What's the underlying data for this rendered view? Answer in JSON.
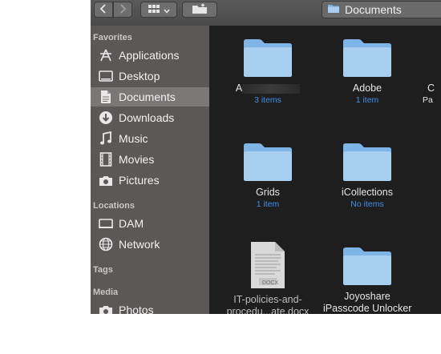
{
  "toolbar": {
    "back_icon": "chevron-left-icon",
    "forward_icon": "chevron-right-icon",
    "path_label": "Documents"
  },
  "sidebar": {
    "favorites_label": "Favorites",
    "favorites": [
      {
        "label": "Applications",
        "icon": "applications-icon"
      },
      {
        "label": "Desktop",
        "icon": "desktop-icon"
      },
      {
        "label": "Documents",
        "icon": "documents-icon",
        "selected": true
      },
      {
        "label": "Downloads",
        "icon": "downloads-icon"
      },
      {
        "label": "Music",
        "icon": "music-icon"
      },
      {
        "label": "Movies",
        "icon": "movies-icon"
      },
      {
        "label": "Pictures",
        "icon": "pictures-icon"
      }
    ],
    "locations_label": "Locations",
    "locations": [
      {
        "label": "DAM",
        "icon": "drive-icon"
      },
      {
        "label": "Network",
        "icon": "network-icon"
      }
    ],
    "tags_label": "Tags",
    "media_label": "Media",
    "media": [
      {
        "label": "Photos",
        "icon": "photos-icon"
      }
    ]
  },
  "content": {
    "items": [
      {
        "name": "A",
        "count": "3 items",
        "type": "folder"
      },
      {
        "name": "Adobe",
        "count": "1 item",
        "type": "folder"
      },
      {
        "name": "C",
        "count": "Pa",
        "type": "partial"
      },
      {
        "name": "Grids",
        "count": "1 item",
        "type": "folder"
      },
      {
        "name": "iCollections",
        "count": "No items",
        "type": "folder"
      },
      {
        "name": "IT-policies-and-",
        "name2": "procedu...ate.docx",
        "type": "docx",
        "doc_label": "DOCX"
      },
      {
        "name": "Joyoshare",
        "name2": "iPasscode Unlocker",
        "type": "folder"
      }
    ]
  },
  "colors": {
    "folder_top": "#a7cdef",
    "folder_body": "#7fb4e6",
    "count_blue": "#3f8fe8",
    "sidebar_bg": "#5b5857",
    "content_bg": "#1e1e1e"
  }
}
